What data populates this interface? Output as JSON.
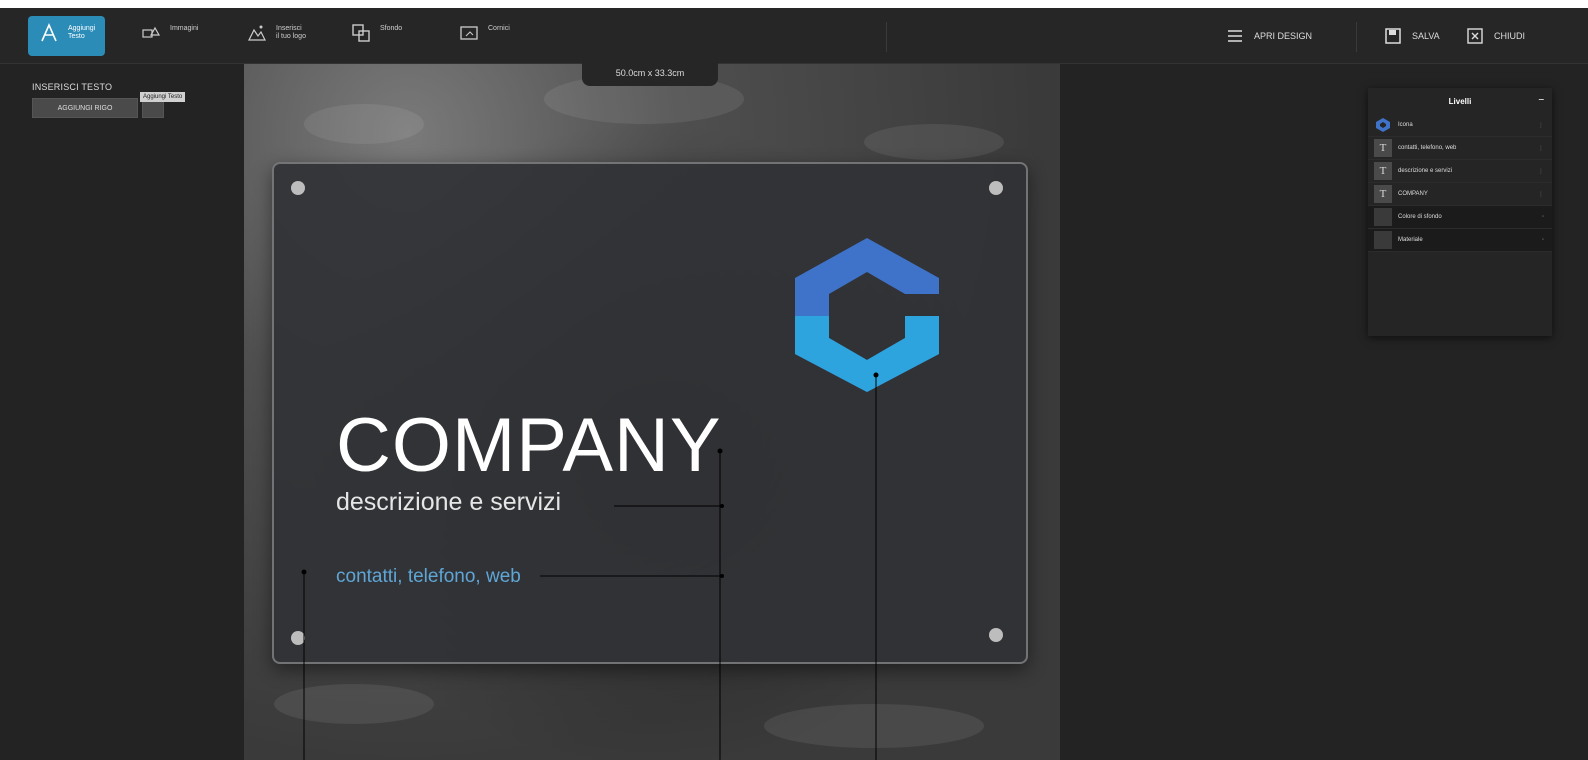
{
  "toolbar": {
    "tools": [
      {
        "label": "Aggiungi\nTesto"
      },
      {
        "label": "Immagini"
      },
      {
        "label": "Inserisci\nil tuo logo"
      },
      {
        "label": "Sfondo"
      },
      {
        "label": "Cornici"
      }
    ],
    "open_design": "APRI DESIGN",
    "save": "SALVA",
    "close": "CHIUDI"
  },
  "left_panel": {
    "title": "INSERISCI TESTO",
    "add_row_button": "AGGIUNGI RIGO",
    "tooltip": "Aggiungi Testo"
  },
  "canvas": {
    "dimensions": "50.0cm x 33.3cm",
    "company": "COMPANY",
    "description": "descrizione e servizi",
    "contacts": "contatti, telefono, web"
  },
  "layers": {
    "title": "Livelli",
    "minimize": "–",
    "items": [
      {
        "label": "Icona",
        "icon": "hexagon-logo-icon"
      },
      {
        "label": "contatti, telefono, web",
        "icon": "text-icon"
      },
      {
        "label": "descrizione e servizi",
        "icon": "text-icon"
      },
      {
        "label": "COMPANY",
        "icon": "text-icon"
      },
      {
        "label": "Colore di sfondo",
        "icon": "swatch-icon"
      },
      {
        "label": "Materiale",
        "icon": "swatch-icon"
      }
    ]
  },
  "colors": {
    "accent": "#2b8cb8",
    "logo_top": "#3f73c9",
    "logo_bottom": "#2ea4df",
    "contact_text": "#5fa6d6"
  }
}
